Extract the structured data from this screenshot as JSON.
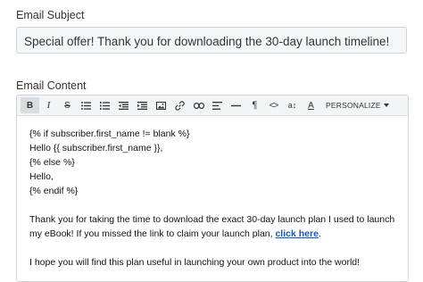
{
  "subject": {
    "label": "Email Subject",
    "value": "Special offer! Thank you for downloading the 30-day launch timeline!"
  },
  "content": {
    "label": "Email Content",
    "toolbar": {
      "bold": "B",
      "italic": "I",
      "strike": "S",
      "personalize_label": "PERSONALIZE",
      "text_size": "a↕",
      "font_color": "A",
      "paragraph": "¶",
      "code": "<>"
    },
    "body_lines": [
      "{% if subscriber.first_name != blank %}",
      "Hello {{ subscriber.first_name }},",
      "{% else %}",
      "Hello,",
      "{% endif %}"
    ],
    "paragraph1_text": "Thank you for taking the time to download the exact 30-day launch plan I used to launch my eBook! If you missed the link to claim your launch plan, ",
    "paragraph1_link": "click here",
    "paragraph1_end": ".",
    "paragraph2": "I hope you will find this plan useful in launching your own product into the world!"
  }
}
